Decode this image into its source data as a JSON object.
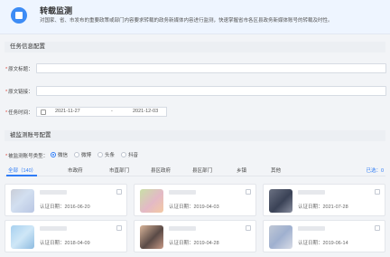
{
  "banner": {
    "title": "转载监测",
    "description": "对国家、省、市发布的重要政策或部门内容要求转载的政务新媒体内容进行监测，快速掌握省市各区县政务新媒体账号的转载及时性。"
  },
  "task_section": {
    "title": "任务信息配置"
  },
  "fields": {
    "article_title_label": "原文标题：",
    "article_link_label": "原文链接：",
    "task_time_label": "任务时间："
  },
  "date_range": {
    "start": "2021-11-27",
    "separator": "-",
    "end": "2021-12-03"
  },
  "monitor_section": {
    "title": "被监测账号配置"
  },
  "platform": {
    "label": "被监测账号类型：",
    "options": [
      "微信",
      "微博",
      "头条",
      "抖音"
    ],
    "selected_index": 0
  },
  "tabs": {
    "items": [
      "全部（140）",
      "市政府",
      "市直部门",
      "县区政府",
      "县区部门",
      "乡镇",
      "其他"
    ],
    "active_index": 0,
    "selected_count": "已选：0"
  },
  "cards": [
    {
      "date": "认证日期：2016-06-20"
    },
    {
      "date": "认证日期：2019-04-03"
    },
    {
      "date": "认证日期：2021-07-28"
    },
    {
      "date": "认证日期：2018-04-09"
    },
    {
      "date": "认证日期：2019-04-28"
    },
    {
      "date": "认证日期：2019-06-14"
    }
  ],
  "colors": {
    "accent": "#2f7cf6",
    "required_star": "#e0463a"
  }
}
